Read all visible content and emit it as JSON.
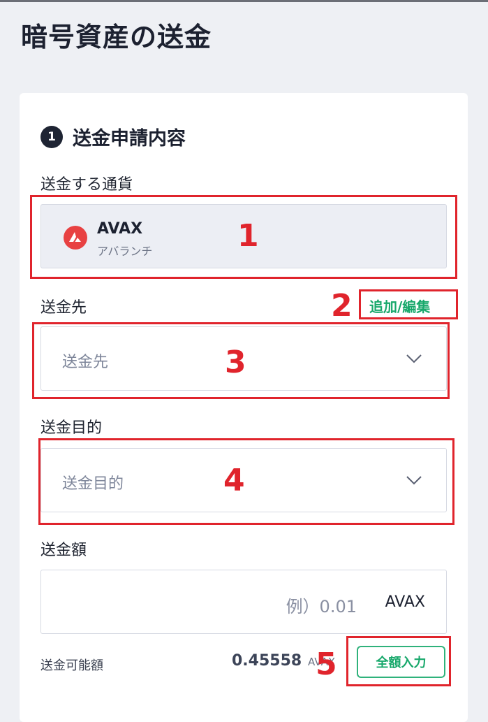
{
  "page": {
    "title": "暗号資産の送金"
  },
  "section": {
    "step": "1",
    "title": "送金申請内容"
  },
  "currency": {
    "label": "送金する通貨",
    "code": "AVAX",
    "name": "アバランチ",
    "icon": "avax-logo-icon",
    "icon_color": "#e84142"
  },
  "destination": {
    "label": "送金先",
    "placeholder": "送金先",
    "add_edit_link": "追加/編集"
  },
  "purpose": {
    "label": "送金目的",
    "placeholder": "送金目的"
  },
  "amount": {
    "label": "送金額",
    "placeholder": "例）0.01",
    "unit": "AVAX"
  },
  "available": {
    "label": "送金可能額",
    "value": "0.45558",
    "unit": "AVAX",
    "fill_all_button": "全額入力"
  },
  "annotations": [
    "1",
    "2",
    "3",
    "4",
    "5"
  ],
  "colors": {
    "accent_green": "#18a86b",
    "annotation_red": "#e0242c",
    "dark": "#1e2433"
  }
}
